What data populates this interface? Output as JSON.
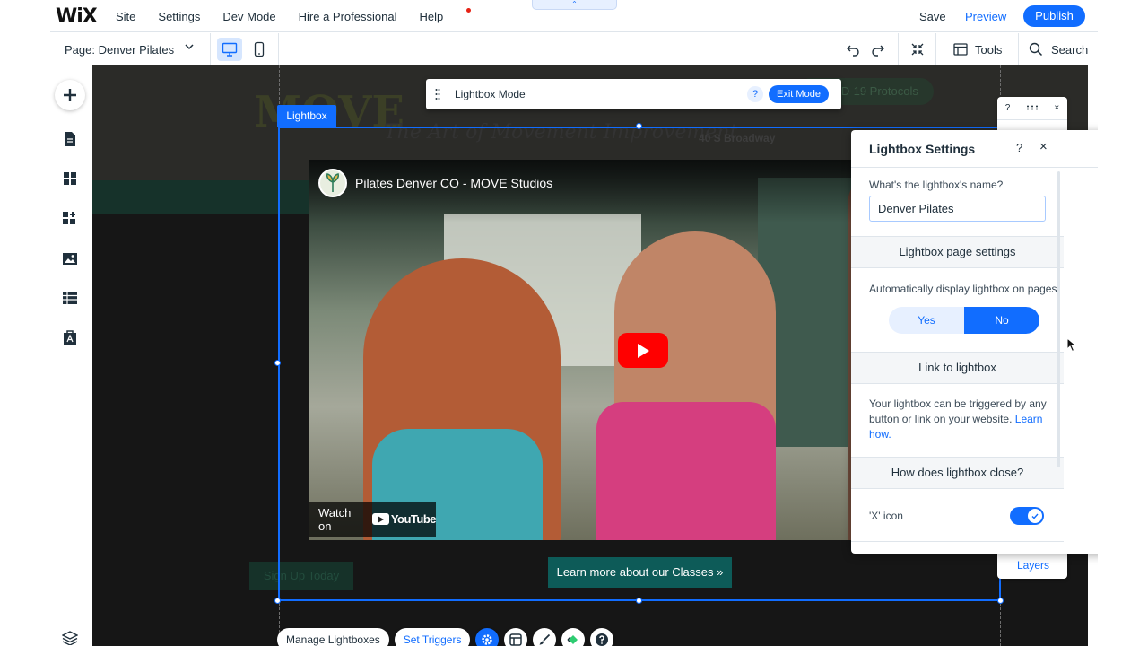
{
  "topbar": {
    "logo": "WiX",
    "nav": [
      "Site",
      "Settings",
      "Dev Mode",
      "Hire a Professional",
      "Help"
    ],
    "tab_handle_glyph": "⌃",
    "save": "Save",
    "preview": "Preview",
    "publish": "Publish"
  },
  "secondbar": {
    "page_label": "Page: Denver Pilates",
    "tools": "Tools",
    "search": "Search"
  },
  "canvas": {
    "covid_button": "COVID-19 Protocols",
    "address": "40 S Broadway",
    "bg_logo": "MOVE",
    "bg_slogan": "The Art of Movement Improvement",
    "sign_up": "Sign Up Today",
    "lightbox_tag": "Lightbox",
    "learn_more": "Learn more about our Classes »"
  },
  "video": {
    "title": "Pilates Denver CO - MOVE Studios",
    "watch_on": "Watch on",
    "youtube": "YouTube"
  },
  "lightbox_mode": {
    "label": "Lightbox Mode",
    "help": "?",
    "exit": "Exit Mode"
  },
  "bottombar": {
    "manage": "Manage Lightboxes",
    "triggers": "Set Triggers"
  },
  "mini_panel": {
    "help": "?",
    "close": "×",
    "layers": "Layers"
  },
  "settings": {
    "title": "Lightbox Settings",
    "help": "?",
    "close": "×",
    "name_question": "What's the lightbox's name?",
    "name_value": "Denver Pilates",
    "section_page": "Lightbox page settings",
    "auto_display": "Automatically display lightbox on pages",
    "yes": "Yes",
    "no": "No",
    "section_link": "Link to lightbox",
    "link_text": "Your lightbox can be triggered by any button or link on your website.",
    "learn_how": "Learn how.",
    "section_close": "How does lightbox close?",
    "x_icon_label": "'X' icon"
  },
  "colors": {
    "accent": "#116dff",
    "canvas_dark": "#1c1c1c",
    "cta_teal": "#0d5b58",
    "youtube_red": "#ff0000"
  }
}
